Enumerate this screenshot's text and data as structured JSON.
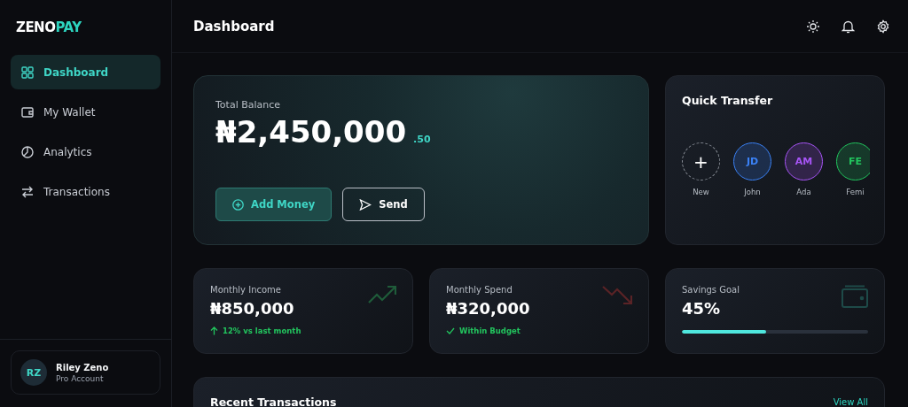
{
  "brand": {
    "first": "ZENO",
    "second": "PAY"
  },
  "sidebar": {
    "items": [
      {
        "label": "Dashboard",
        "selected": true
      },
      {
        "label": "My Wallet",
        "selected": false
      },
      {
        "label": "Analytics",
        "selected": false
      },
      {
        "label": "Transactions",
        "selected": false
      }
    ],
    "user": {
      "initials": "RZ",
      "name": "Riley Zeno",
      "plan": "Pro Account"
    }
  },
  "header": {
    "title": "Dashboard"
  },
  "balance": {
    "label": "Total Balance",
    "amount": "₦2,450,000",
    "cents": ".50",
    "buttons": [
      {
        "label": "Add Money",
        "kind": "primary"
      },
      {
        "label": "Send",
        "kind": "outline"
      }
    ]
  },
  "quick_transfer": {
    "title": "Quick Transfer",
    "contacts": [
      {
        "kind": "new",
        "symbol": "+",
        "name": "New"
      },
      {
        "kind": "contact",
        "initials": "JD",
        "name": "John",
        "color": "#3b82f6"
      },
      {
        "kind": "contact",
        "initials": "AM",
        "name": "Ada",
        "color": "#a855f7"
      },
      {
        "kind": "contact",
        "initials": "FE",
        "name": "Femi",
        "color": "#22c55e"
      }
    ]
  },
  "stats": [
    {
      "kind": "up",
      "label": "Monthly Income",
      "value": "₦850,000",
      "note": "12% vs last month"
    },
    {
      "kind": "down",
      "label": "Monthly Spend",
      "value": "₦320,000",
      "note": "Within Budget"
    },
    {
      "kind": "progress",
      "label": "Savings Goal",
      "value": "45%",
      "level": 0.45
    }
  ],
  "recent": {
    "title": "Recent Transactions",
    "link": "View All"
  }
}
